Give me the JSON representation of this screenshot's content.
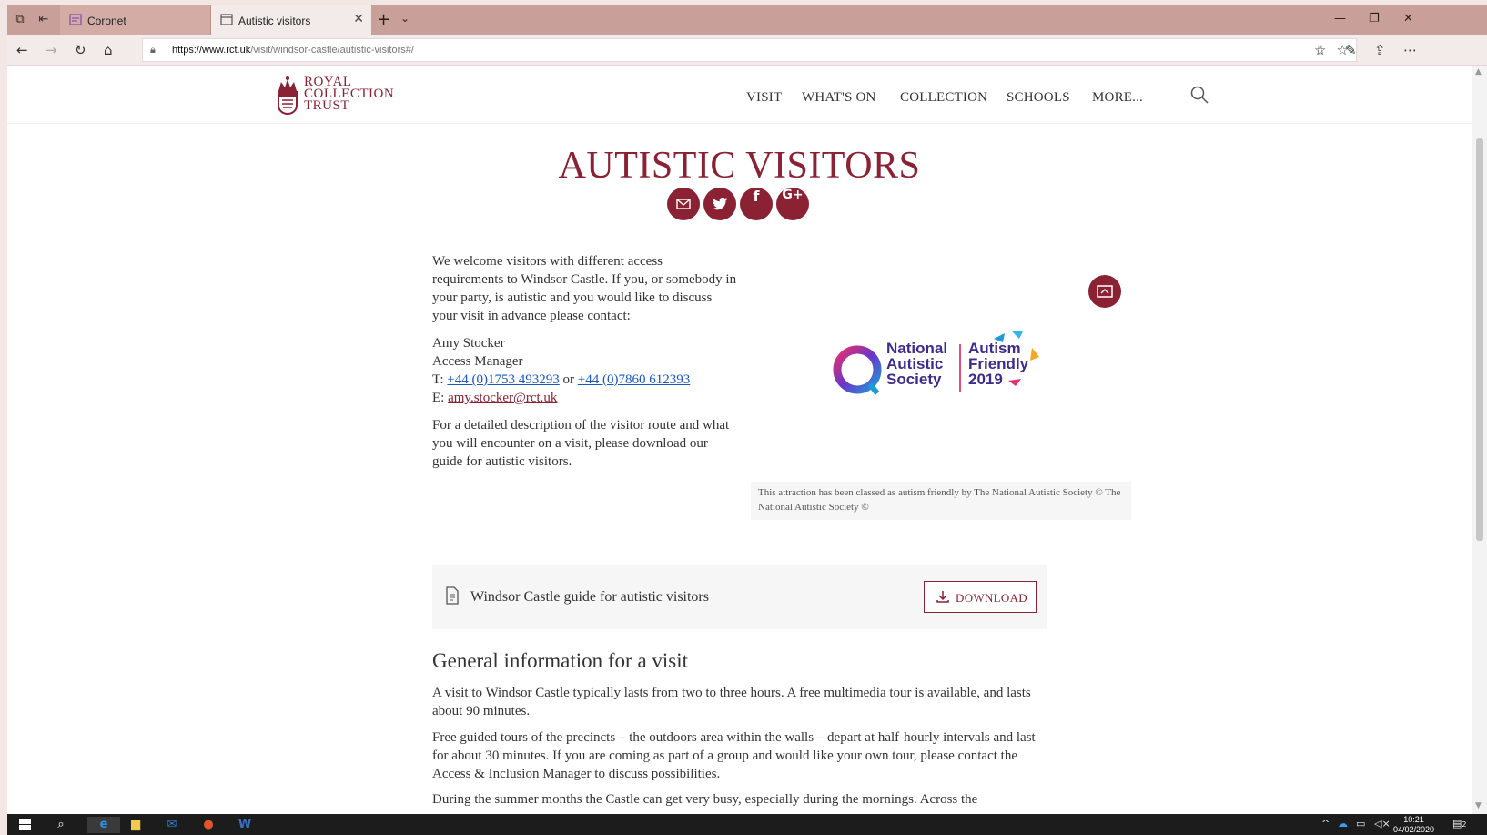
{
  "browser": {
    "tabs": [
      {
        "label": "Coronet"
      },
      {
        "label": "Autistic visitors"
      }
    ],
    "url_host": "https://www.rct.uk",
    "url_path": "/visit/windsor-castle/autistic-visitors#/"
  },
  "site": {
    "logo_lines": [
      "ROYAL",
      "COLLECTION",
      "TRUST"
    ],
    "nav": [
      "VISIT",
      "WHAT'S ON",
      "COLLECTION",
      "SCHOOLS",
      "MORE..."
    ]
  },
  "page": {
    "title": "AUTISTIC VISITORS",
    "intro": "We welcome visitors with different access requirements to Windsor Castle. If you, or somebody in your party, is autistic and you would like to discuss your visit in advance please contact:",
    "contact": {
      "name": "Amy Stocker",
      "role": "Access Manager",
      "phone_prefix": "T:",
      "phone1": "+44 (0)1753 493293",
      "or": "or",
      "phone2": "+44 (0)7860 612393",
      "email_prefix": "E:",
      "email": "amy.stocker@rct.uk"
    },
    "guide_text": "For a detailed description of the visitor route and what you will encounter on a visit, please download our guide for autistic visitors.",
    "nas_logo": {
      "org": [
        "National",
        "Autistic",
        "Society"
      ],
      "badge": [
        "Autism",
        "Friendly",
        "2019"
      ]
    },
    "caption": "This attraction has been classed as autism friendly by The National Autistic Society © The National Autistic Society ©",
    "download": {
      "label": "Windsor Castle guide for autistic visitors",
      "button": "DOWNLOAD"
    },
    "general_heading": "General information for a visit",
    "paragraphs": [
      "A visit to Windsor Castle typically lasts from two to three hours. A free multimedia tour is available, and lasts about 90 minutes.",
      "Free guided tours of the precincts – the outdoors area within the walls – depart at half-hourly intervals and last for about 30 minutes. If you are coming as part of a group and would like your own tour, please contact the Access & Inclusion Manager to discuss possibilities.",
      "During the summer months the Castle can get very busy, especially during the mornings. Across the"
    ]
  },
  "taskbar": {
    "time": "10:21",
    "date": "04/02/2020",
    "notification_count": "2"
  },
  "colors": {
    "brand": "#8a2234",
    "link": "#1a56c4",
    "tabbar": "#c9a099"
  }
}
